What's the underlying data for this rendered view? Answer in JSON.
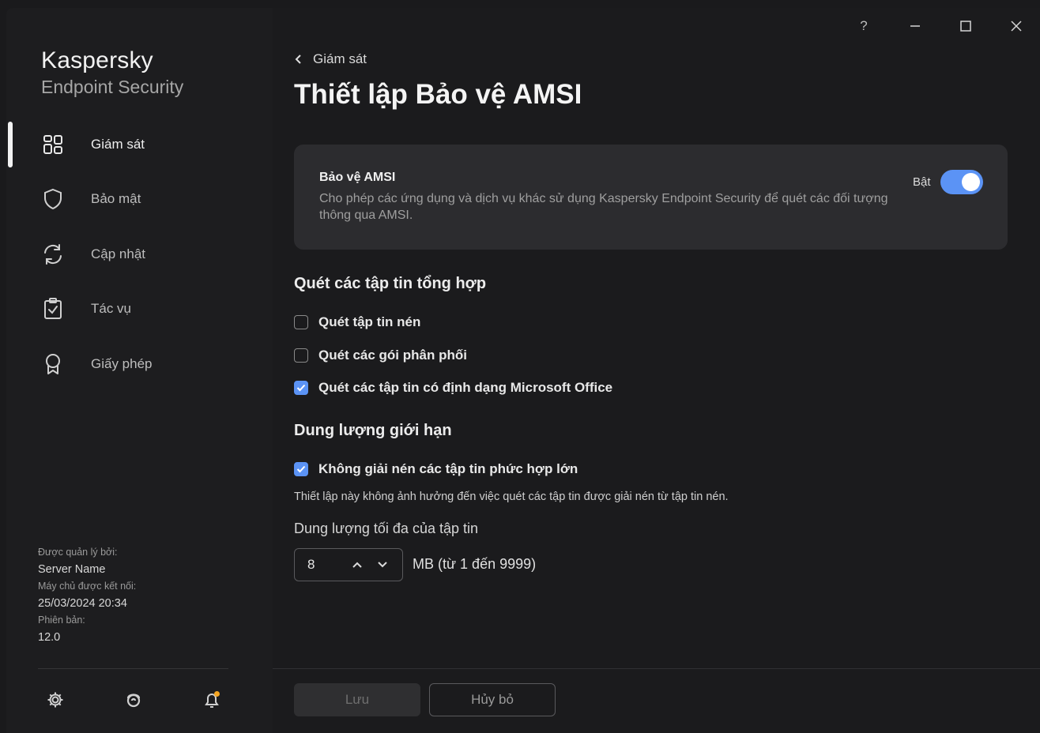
{
  "window": {
    "controls": {
      "help": "?",
      "minimize": "minimize",
      "maximize": "maximize",
      "close": "close"
    }
  },
  "brand": {
    "name": "Kaspersky",
    "product": "Endpoint Security"
  },
  "sidebar": {
    "items": [
      {
        "label": "Giám sát",
        "icon": "dashboard-icon",
        "active": true
      },
      {
        "label": "Bảo mật",
        "icon": "shield-icon",
        "active": false
      },
      {
        "label": "Cập nhật",
        "icon": "refresh-icon",
        "active": false
      },
      {
        "label": "Tác vụ",
        "icon": "clipboard-check-icon",
        "active": false
      },
      {
        "label": "Giấy phép",
        "icon": "award-icon",
        "active": false
      }
    ],
    "meta": {
      "managed_by_label": "Được quản lý bởi:",
      "managed_by_value": "Server Name",
      "connected_label": "Máy chủ được kết nối:",
      "connected_value": "25/03/2024 20:34",
      "version_label": "Phiên bản:",
      "version_value": "12.0"
    },
    "bottom_icons": [
      "settings-icon",
      "support-icon",
      "notifications-icon"
    ]
  },
  "main": {
    "breadcrumb": "Giám sát",
    "title": "Thiết lập Bảo vệ AMSI",
    "card": {
      "title": "Bảo vệ AMSI",
      "description": "Cho phép các ứng dụng và dịch vụ khác sử dụng Kaspersky Endpoint Security để quét các đối tượng thông qua AMSI.",
      "toggle_label": "Bật",
      "toggle_on": true
    },
    "section_compound": {
      "title": "Quét các tập tin tổng hợp",
      "options": [
        {
          "label": "Quét tập tin nén",
          "checked": false
        },
        {
          "label": "Quét các gói phân phối",
          "checked": false
        },
        {
          "label": "Quét các tập tin có định dạng Microsoft Office",
          "checked": true
        }
      ]
    },
    "section_limit": {
      "title": "Dung lượng giới hạn",
      "option_label": "Không giải nén các tập tin phức hợp lớn",
      "option_checked": true,
      "hint": "Thiết lập này không ảnh hưởng đến việc quét các tập tin được giải nén từ tập tin nén.",
      "size_label": "Dung lượng tối đa của tập tin",
      "size_value": "8",
      "size_unit": "MB (từ 1 đến 9999)"
    },
    "footer": {
      "save": "Lưu",
      "cancel": "Hủy bỏ"
    }
  },
  "colors": {
    "accent": "#5b93f5",
    "card": "#2c2c2f",
    "background": "#1b1b1d"
  }
}
